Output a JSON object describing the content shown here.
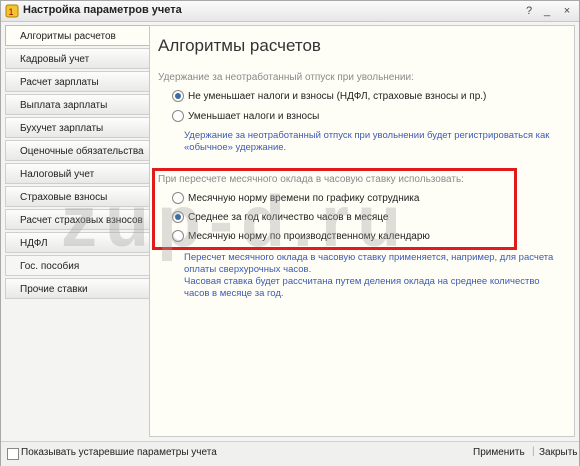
{
  "window": {
    "title": "Настройка параметров учета",
    "help": "?",
    "minimize": "_",
    "close": "×"
  },
  "sidebar": {
    "items": [
      {
        "label": "Алгоритмы расчетов",
        "active": true
      },
      {
        "label": "Кадровый учет"
      },
      {
        "label": "Расчет зарплаты"
      },
      {
        "label": "Выплата зарплаты"
      },
      {
        "label": "Бухучет зарплаты"
      },
      {
        "label": "Оценочные обязательства"
      },
      {
        "label": "Налоговый учет"
      },
      {
        "label": "Страховые взносы"
      },
      {
        "label": "Расчет страховых взносов"
      },
      {
        "label": "НДФЛ"
      },
      {
        "label": "Гос. пособия"
      },
      {
        "label": "Прочие ставки"
      }
    ]
  },
  "main": {
    "title": "Алгоритмы расчетов",
    "section1": {
      "label": "Удержание за неотработанный отпуск при увольнении:",
      "options": [
        "Не уменьшает налоги и взносы (НДФЛ, страховые взносы и пр.)",
        "Уменьшает налоги и взносы"
      ],
      "selected": 0,
      "hint": [
        "Удержание за неотработанный отпуск при увольнении будет регистрироваться как",
        "«обычное» удержание."
      ]
    },
    "section2": {
      "label": "При пересчете месячного оклада в часовую ставку использовать:",
      "options": [
        "Месячную норму времени по графику сотрудника",
        "Среднее за год количество часов в месяце",
        "Месячную норму по производственному календарю"
      ],
      "selected": 1,
      "hint": [
        "Пересчет месячного оклада в часовую ставку применяется, например, для расчета",
        "оплаты сверхурочных часов.",
        "Часовая ставка будет рассчитана путем деления оклада на среднее количество",
        "часов в месяце за год."
      ]
    }
  },
  "watermark": "zup-d.ru",
  "footer": {
    "checkbox_label": "Показывать устаревшие параметры учета",
    "apply": "Применить",
    "separator": "|",
    "close": "Закрыть"
  },
  "colors": {
    "accent": "#3a6ea5",
    "highlight": "#e01b1b",
    "hint": "#3b5bb5"
  }
}
